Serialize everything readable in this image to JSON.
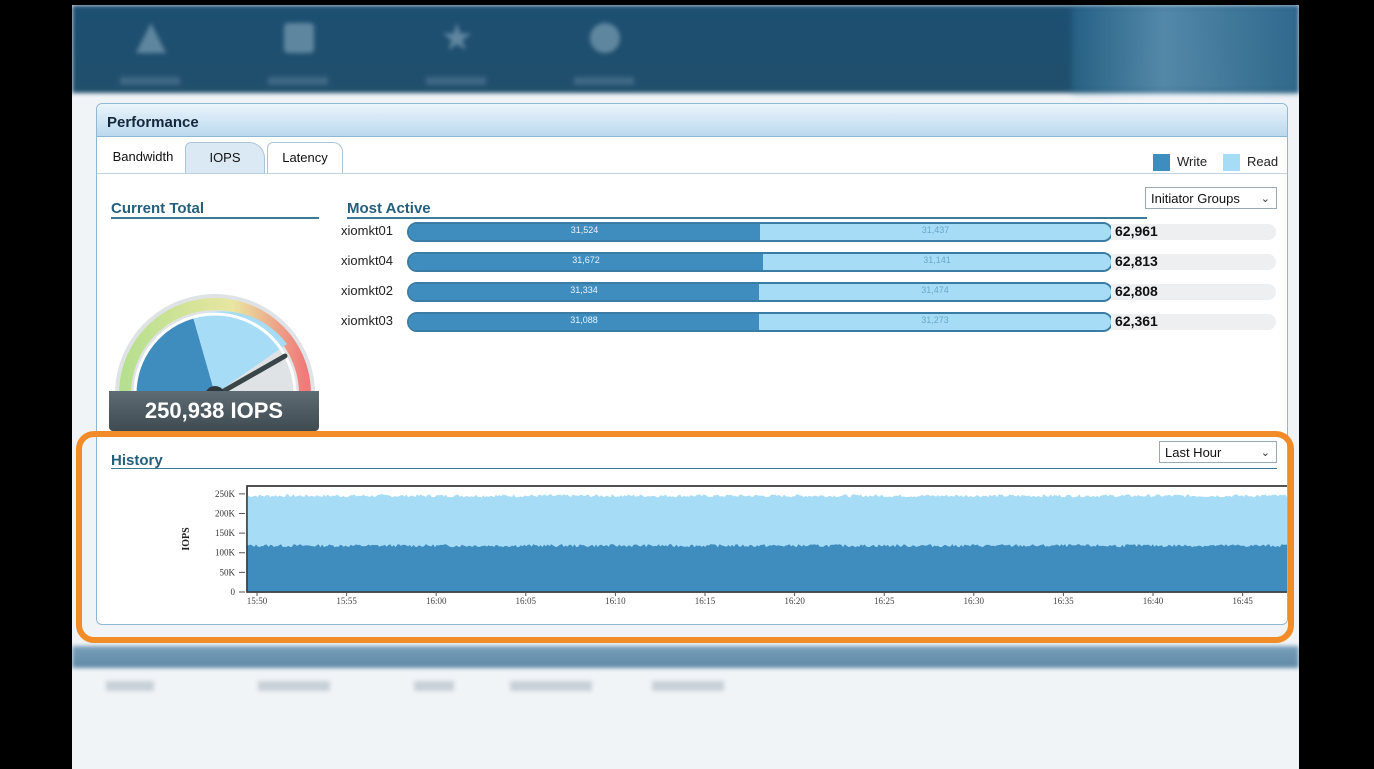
{
  "panel": {
    "title": "Performance"
  },
  "tabs": [
    {
      "label": "Bandwidth",
      "active": false
    },
    {
      "label": "IOPS",
      "active": true
    },
    {
      "label": "Latency",
      "active": false
    }
  ],
  "legend": [
    {
      "label": "Write",
      "color": "#3f8dbf"
    },
    {
      "label": "Read",
      "color": "#a6dcf5"
    }
  ],
  "current_total": {
    "title": "Current Total",
    "value": "250,938 IOPS"
  },
  "most_active": {
    "title": "Most Active",
    "filter": "Initiator Groups",
    "rows": [
      {
        "name": "xiomkt01",
        "write": 31524,
        "read": 31437,
        "write_label": "31,524",
        "read_label": "31,437",
        "total": "62,961"
      },
      {
        "name": "xiomkt04",
        "write": 31672,
        "read": 31141,
        "write_label": "31,672",
        "read_label": "31,141",
        "total": "62,813"
      },
      {
        "name": "xiomkt02",
        "write": 31334,
        "read": 31474,
        "write_label": "31,334",
        "read_label": "31,474",
        "total": "62,808"
      },
      {
        "name": "xiomkt03",
        "write": 31088,
        "read": 31273,
        "write_label": "31,088",
        "read_label": "31,273",
        "total": "62,361"
      }
    ]
  },
  "history": {
    "title": "History",
    "range": "Last Hour"
  },
  "chart_data": {
    "type": "area",
    "title": "",
    "xlabel": "",
    "ylabel": "IOPS",
    "x": [
      "15:50",
      "15:55",
      "16:00",
      "16:05",
      "16:10",
      "16:15",
      "16:20",
      "16:25",
      "16:30",
      "16:35",
      "16:40",
      "16:45"
    ],
    "yticks": [
      "0",
      "50K",
      "100K",
      "150K",
      "200K",
      "250K"
    ],
    "ylim": [
      0,
      270000
    ],
    "series": [
      {
        "name": "Write",
        "color": "#3f8dbf",
        "values": [
          118000,
          118000,
          118000,
          118000,
          118000,
          118000,
          118000,
          118000,
          118000,
          118000,
          118000,
          118000
        ]
      },
      {
        "name": "Read",
        "color": "#a6dcf5",
        "values": [
          127000,
          127000,
          127000,
          127000,
          127000,
          127000,
          127000,
          127000,
          127000,
          127000,
          127000,
          127000
        ]
      }
    ],
    "stacked": true,
    "grid": false
  }
}
